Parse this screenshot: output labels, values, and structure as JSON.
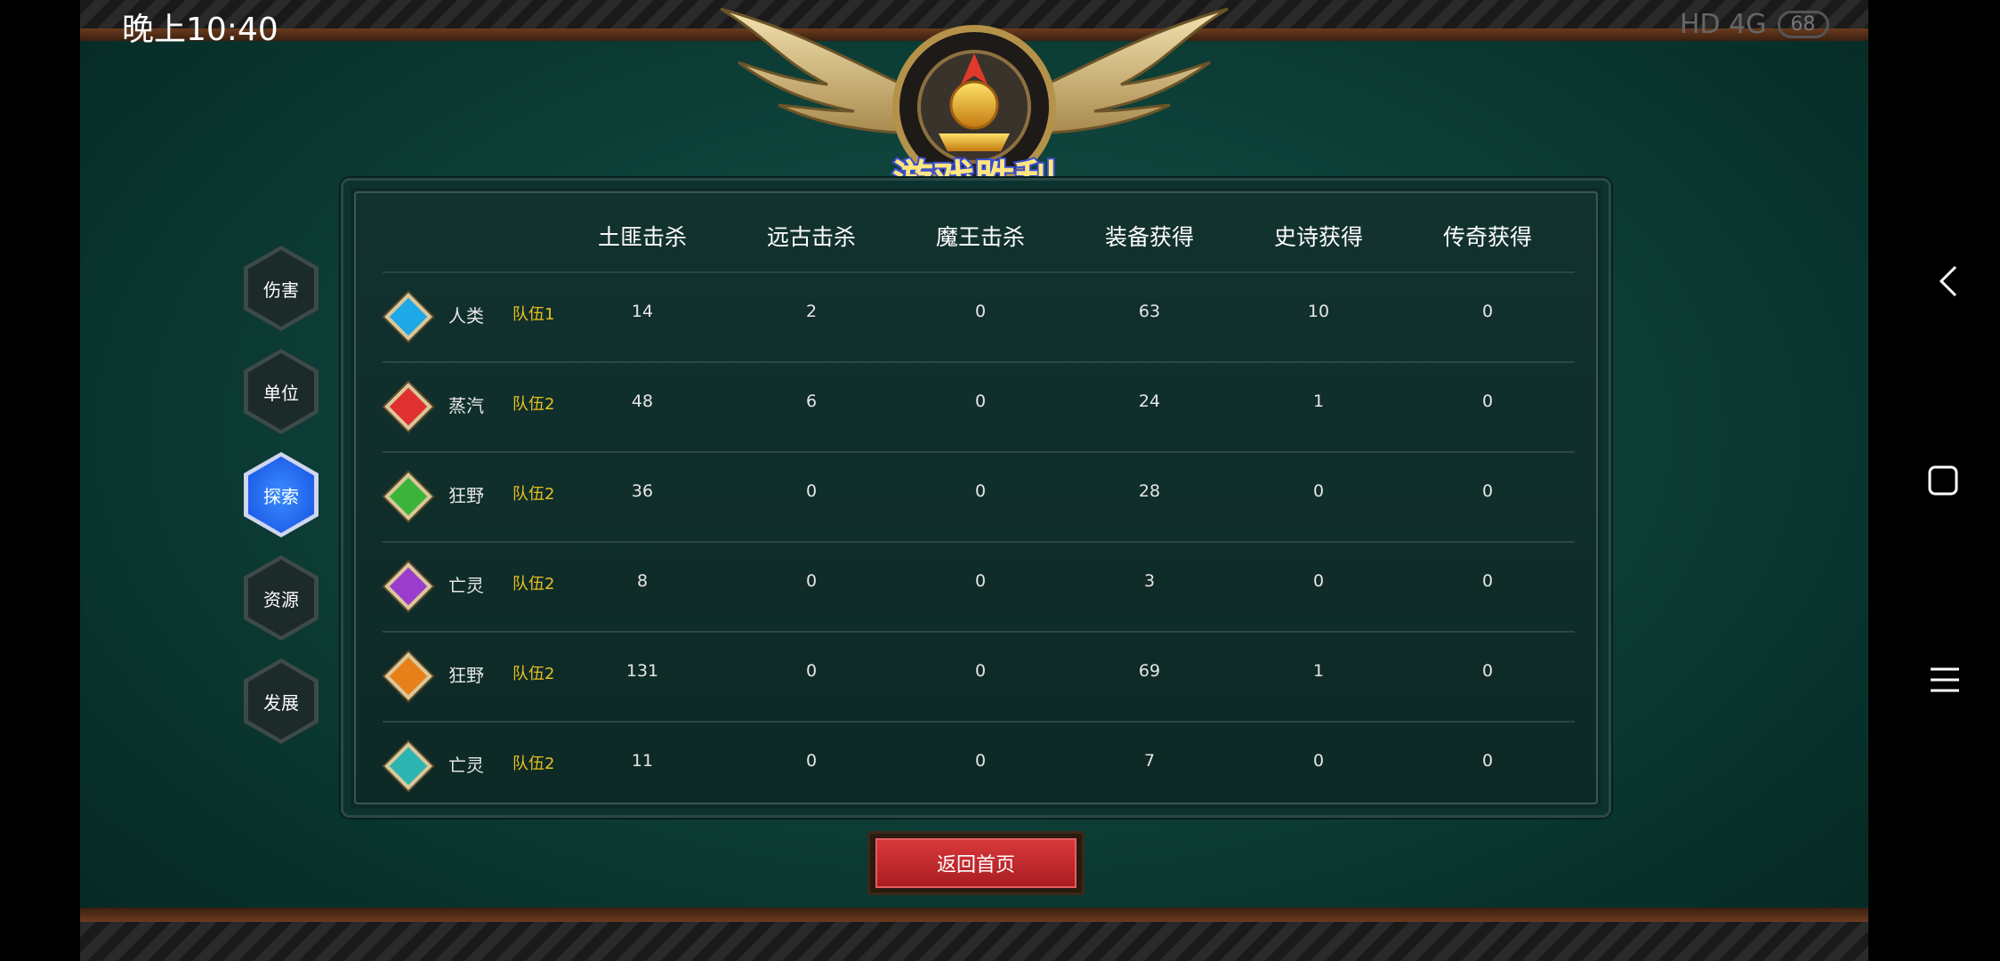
{
  "status_bar": {
    "time": "晚上10:40",
    "network": "HD 4G",
    "battery": "68"
  },
  "title": "游戏胜利",
  "side_tabs": [
    {
      "label": "伤害",
      "active": false
    },
    {
      "label": "单位",
      "active": false
    },
    {
      "label": "探索",
      "active": true
    },
    {
      "label": "资源",
      "active": false
    },
    {
      "label": "发展",
      "active": false
    }
  ],
  "table": {
    "columns": [
      "土匪击杀",
      "远古击杀",
      "魔王击杀",
      "装备获得",
      "史诗获得",
      "传奇获得"
    ],
    "rows": [
      {
        "gem_color": "#1fa8e8",
        "faction": "人类",
        "team": "队伍1",
        "values": [
          "14",
          "2",
          "0",
          "63",
          "10",
          "0"
        ]
      },
      {
        "gem_color": "#e03030",
        "faction": "蒸汽",
        "team": "队伍2",
        "values": [
          "48",
          "6",
          "0",
          "24",
          "1",
          "0"
        ]
      },
      {
        "gem_color": "#3cb43c",
        "faction": "狂野",
        "team": "队伍2",
        "values": [
          "36",
          "0",
          "0",
          "28",
          "0",
          "0"
        ]
      },
      {
        "gem_color": "#9a3ccc",
        "faction": "亡灵",
        "team": "队伍2",
        "values": [
          "8",
          "0",
          "0",
          "3",
          "0",
          "0"
        ]
      },
      {
        "gem_color": "#e8801a",
        "faction": "狂野",
        "team": "队伍2",
        "values": [
          "131",
          "0",
          "0",
          "69",
          "1",
          "0"
        ]
      },
      {
        "gem_color": "#2cb4b0",
        "faction": "亡灵",
        "team": "队伍2",
        "values": [
          "11",
          "0",
          "0",
          "7",
          "0",
          "0"
        ]
      }
    ]
  },
  "return_button": "返回首页",
  "nav": {
    "back_icon": "back-icon",
    "home_icon": "home-icon",
    "menu_icon": "menu-icon"
  }
}
